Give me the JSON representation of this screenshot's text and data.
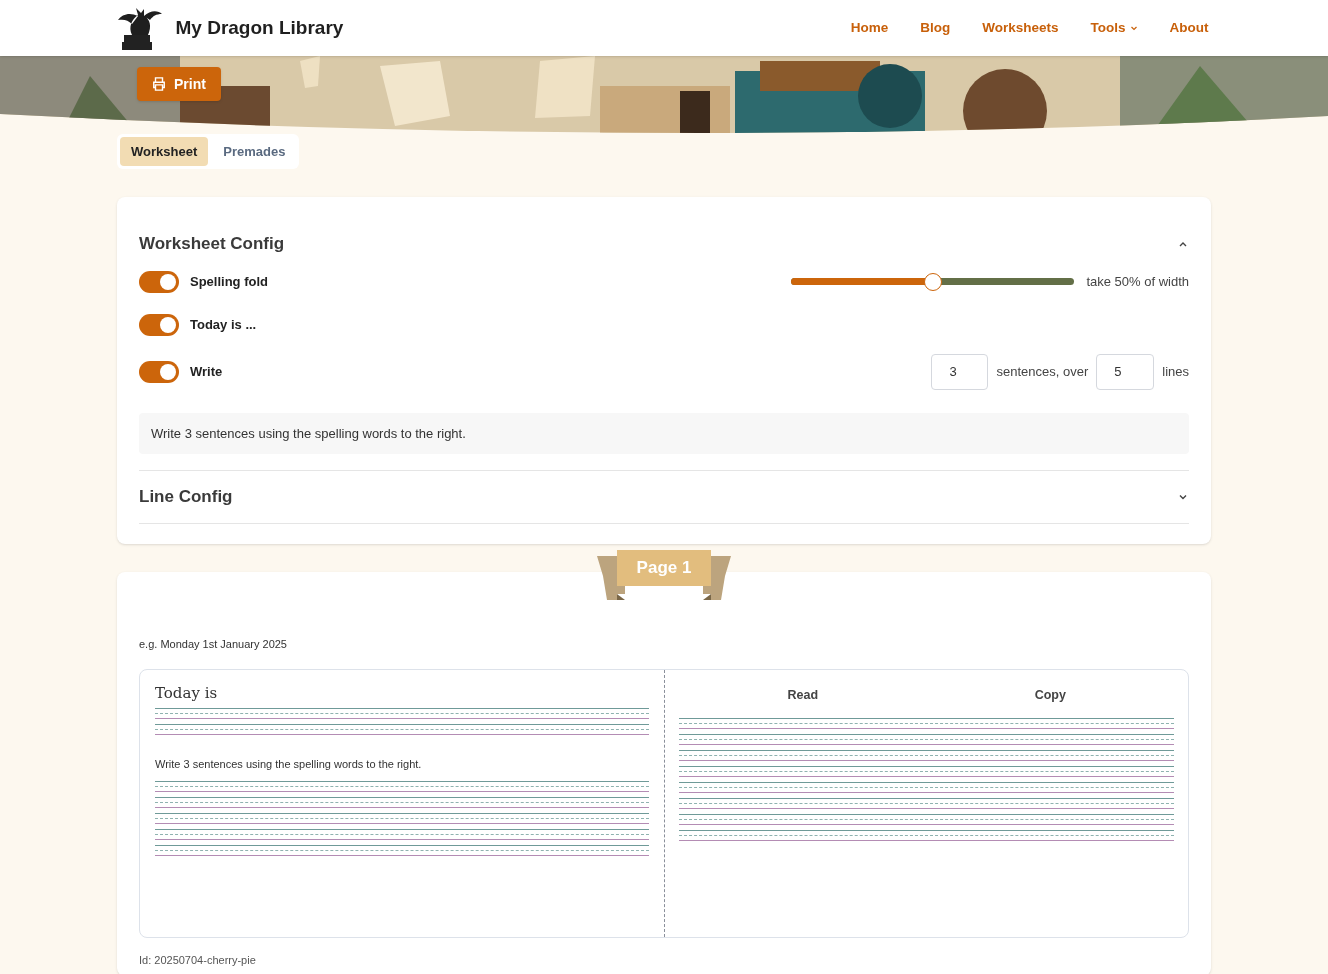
{
  "header": {
    "site_title": "My Dragon Library",
    "nav": [
      {
        "label": "Home",
        "dropdown": false
      },
      {
        "label": "Blog",
        "dropdown": false
      },
      {
        "label": "Worksheets",
        "dropdown": false
      },
      {
        "label": "Tools",
        "dropdown": true
      },
      {
        "label": "About",
        "dropdown": false
      }
    ]
  },
  "print_button": "Print",
  "tabs": [
    {
      "label": "Worksheet",
      "selected": true
    },
    {
      "label": "Premades",
      "selected": false
    }
  ],
  "worksheet_config": {
    "title": "Worksheet Config",
    "expanded": true,
    "options": [
      {
        "kind": "slider",
        "label": "Spelling fold",
        "on": true,
        "level": 0.5,
        "reading": "take 50% of width"
      },
      {
        "kind": "plain",
        "label": "Today is ...",
        "on": true
      },
      {
        "kind": "counts",
        "label": "Write",
        "on": true,
        "sentences": "3",
        "sentences_label": "sentences, over",
        "lines": "5",
        "lines_label": "lines"
      }
    ],
    "prompt": "Write 3 sentences using the spelling words to the right."
  },
  "line_config": {
    "title": "Line Config",
    "expanded": false
  },
  "page": {
    "ribbon": "Page 1",
    "date_hint": "e.g. Monday 1st January 2025",
    "today_heading": "Today is",
    "write_instruction": "Write 3 sentences using the spelling words to the right.",
    "columns": [
      "Read",
      "Copy"
    ],
    "id": "Id: 20250704-cherry-pie"
  }
}
